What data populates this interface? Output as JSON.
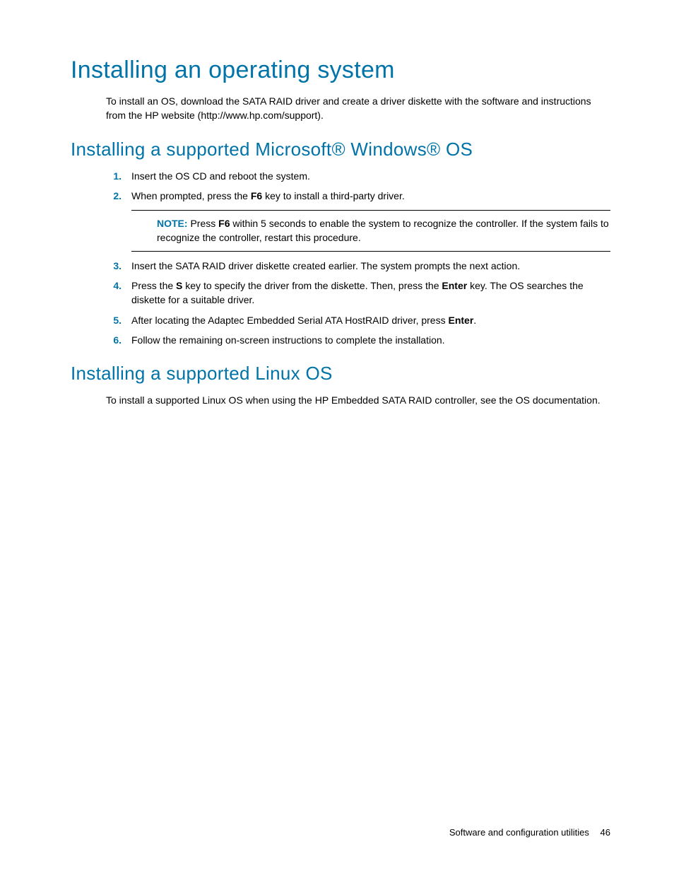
{
  "headings": {
    "h1": "Installing an operating system",
    "h2_windows": "Installing a supported Microsoft® Windows® OS",
    "h2_linux": "Installing a supported Linux OS"
  },
  "paragraphs": {
    "intro": "To install an OS, download the SATA RAID driver and create a driver diskette with the software and instructions from the HP website (http://www.hp.com/support).",
    "linux": "To install a supported Linux OS when using the HP Embedded SATA RAID controller, see the OS documentation."
  },
  "steps": {
    "s1": "Insert the OS CD and reboot the system.",
    "s2_pre": "When prompted, press the ",
    "s2_key": "F6",
    "s2_post": " key to install a third-party driver.",
    "s3": "Insert the SATA RAID driver diskette created earlier. The system prompts the next action.",
    "s4_pre": "Press the ",
    "s4_key1": "S",
    "s4_mid": " key to specify the driver from the diskette. Then, press the ",
    "s4_key2": "Enter",
    "s4_post": " key. The OS searches the diskette for a suitable driver.",
    "s5_pre": "After locating the Adaptec Embedded Serial ATA HostRAID driver, press ",
    "s5_key": "Enter",
    "s5_post": ".",
    "s6": "Follow the remaining on-screen instructions to complete the installation."
  },
  "markers": {
    "m1": "1.",
    "m2": "2.",
    "m3": "3.",
    "m4": "4.",
    "m5": "5.",
    "m6": "6."
  },
  "note": {
    "label": "NOTE:",
    "pre": "  Press ",
    "key": "F6",
    "post": " within 5 seconds to enable the system to recognize the controller. If the system fails to recognize the controller, restart this procedure."
  },
  "footer": {
    "section": "Software and configuration utilities",
    "page": "46"
  }
}
